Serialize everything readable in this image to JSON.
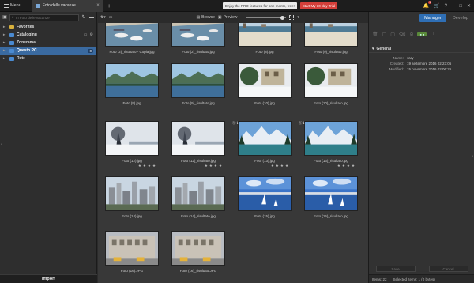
{
  "titlebar": {
    "menu_label": "Menu",
    "tab_label": "Foto delle vacanze",
    "tab_add": "+",
    "promo_text": "Enjoy the PRO features for one month, free!",
    "promo_button": "Start My 30-day Trial",
    "notif_count": "1"
  },
  "left": {
    "search_placeholder": "In Foto delle vacanze",
    "nav": [
      {
        "label": "Favorites",
        "color": "#d8b13c"
      },
      {
        "label": "Cataloging",
        "color": "#4a8ad0"
      },
      {
        "label": "Zonerama",
        "color": "#4a8ad0"
      },
      {
        "label": "Questo PC",
        "color": "#4a8ad0",
        "badge": "0"
      },
      {
        "label": "Rete",
        "color": "#4a8ad0"
      }
    ],
    "import_label": "Import"
  },
  "browser": {
    "browse_label": "Browse",
    "preview_label": "Preview"
  },
  "thumbnails": [
    {
      "caption": "Foto (2)_risultato - Copia.jpg",
      "scene": "harbor"
    },
    {
      "caption": "Foto (2)_risultato.jpg",
      "scene": "harbor"
    },
    {
      "caption": "Foto (8).jpg",
      "scene": "beach"
    },
    {
      "caption": "Foto (9)_risultato.jpg",
      "scene": "beach"
    },
    {
      "caption": "Foto (9).jpg",
      "scene": "lake"
    },
    {
      "caption": "Foto (9)_risultato.jpg",
      "scene": "lake"
    },
    {
      "caption": "Foto (10).jpg",
      "scene": "snowhouse"
    },
    {
      "caption": "Foto (10)_risultato.jpg",
      "scene": "snowhouse"
    },
    {
      "caption": "Foto (12).jpg",
      "scene": "wintertree",
      "stars": "★★★★"
    },
    {
      "caption": "Foto (12)_risultato.jpg",
      "scene": "wintertree",
      "stars": "★★★★"
    },
    {
      "caption": "Foto (13).jpg",
      "scene": "mountains",
      "stars": "★★★★",
      "info": "ⓑ ℹ"
    },
    {
      "caption": "Foto (13)_risultato.jpg",
      "scene": "mountains",
      "stars": "★★★★",
      "info": "ⓑ ℹ"
    },
    {
      "caption": "Foto (14).jpg",
      "scene": "city"
    },
    {
      "caption": "Foto (14)_risultato.jpg",
      "scene": "city"
    },
    {
      "caption": "Foto (15).jpg",
      "scene": "sail"
    },
    {
      "caption": "Foto (15)_risultato.jpg",
      "scene": "sail"
    },
    {
      "caption": "Foto (16).JPG",
      "scene": "building"
    },
    {
      "caption": "Foto (16)_risultato.JPG",
      "scene": "building"
    }
  ],
  "right": {
    "mode_manager": "Manager",
    "mode_develop": "Develop",
    "section_title": "General",
    "fields": [
      {
        "key": "Name:",
        "value": "vary"
      },
      {
        "key": "Created:",
        "value": "19 settembre 2016 02:23:05"
      },
      {
        "key": "Modified:",
        "value": "15 novembre 2016 02:06:26"
      }
    ],
    "save_label": "Save",
    "cancel_label": "Cancel",
    "status_items": "Items: 22",
    "status_selected": "Selected items: 1 (0 bytes)"
  }
}
